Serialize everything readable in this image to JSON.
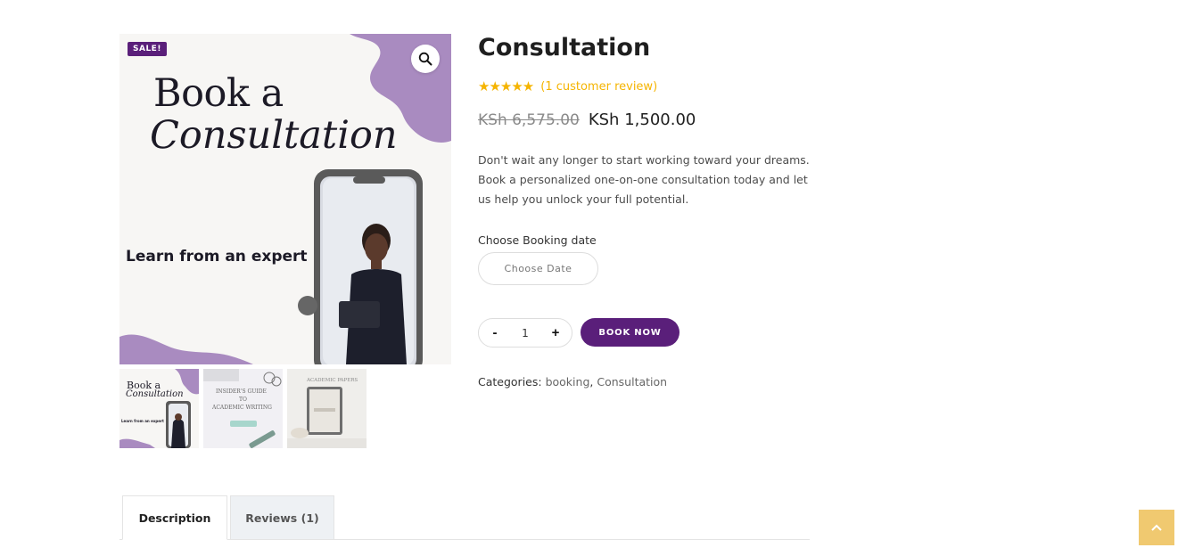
{
  "gallery": {
    "sale_badge": "SALE!",
    "headline_line1": "Book a",
    "headline_line2": "Consultation",
    "tagline": "Learn from an expert",
    "thumbnails": [
      {
        "line1": "Book a",
        "line2": "Consultation",
        "line3": "Learn from an expert"
      },
      {
        "line1": "INSIDER'S GUIDE",
        "line2": "TO",
        "line3": "ACADEMIC WRITING"
      },
      {
        "line1": "ACADEMIC PAPERS"
      }
    ]
  },
  "product": {
    "title": "Consultation",
    "rating_stars": "★★★★★",
    "rating_value": 5,
    "review_link": "(1 customer review)",
    "old_price": "KSh 6,575.00",
    "new_price": "KSh 1,500.00",
    "short_description": "Don't wait any longer to start working toward your dreams. Book a personalized one-on-one consultation today and let us help you unlock your full potential.",
    "booking_label": "Choose Booking date",
    "date_button": "Choose Date",
    "qty_minus": "-",
    "qty_value": "1",
    "qty_plus": "+",
    "book_button": "BOOK NOW",
    "categories_label": "Categories:",
    "category_1": "booking",
    "category_separator": ",",
    "category_2": "Consultation"
  },
  "tabs": [
    {
      "label": "Description",
      "active": true
    },
    {
      "label": "Reviews (1)",
      "active": false
    }
  ],
  "colors": {
    "brand_purple": "#5a1f7a",
    "star_gold": "#f5b400",
    "scroll_top_bg": "#f0c970",
    "blob_lavender": "#a98bc0"
  }
}
